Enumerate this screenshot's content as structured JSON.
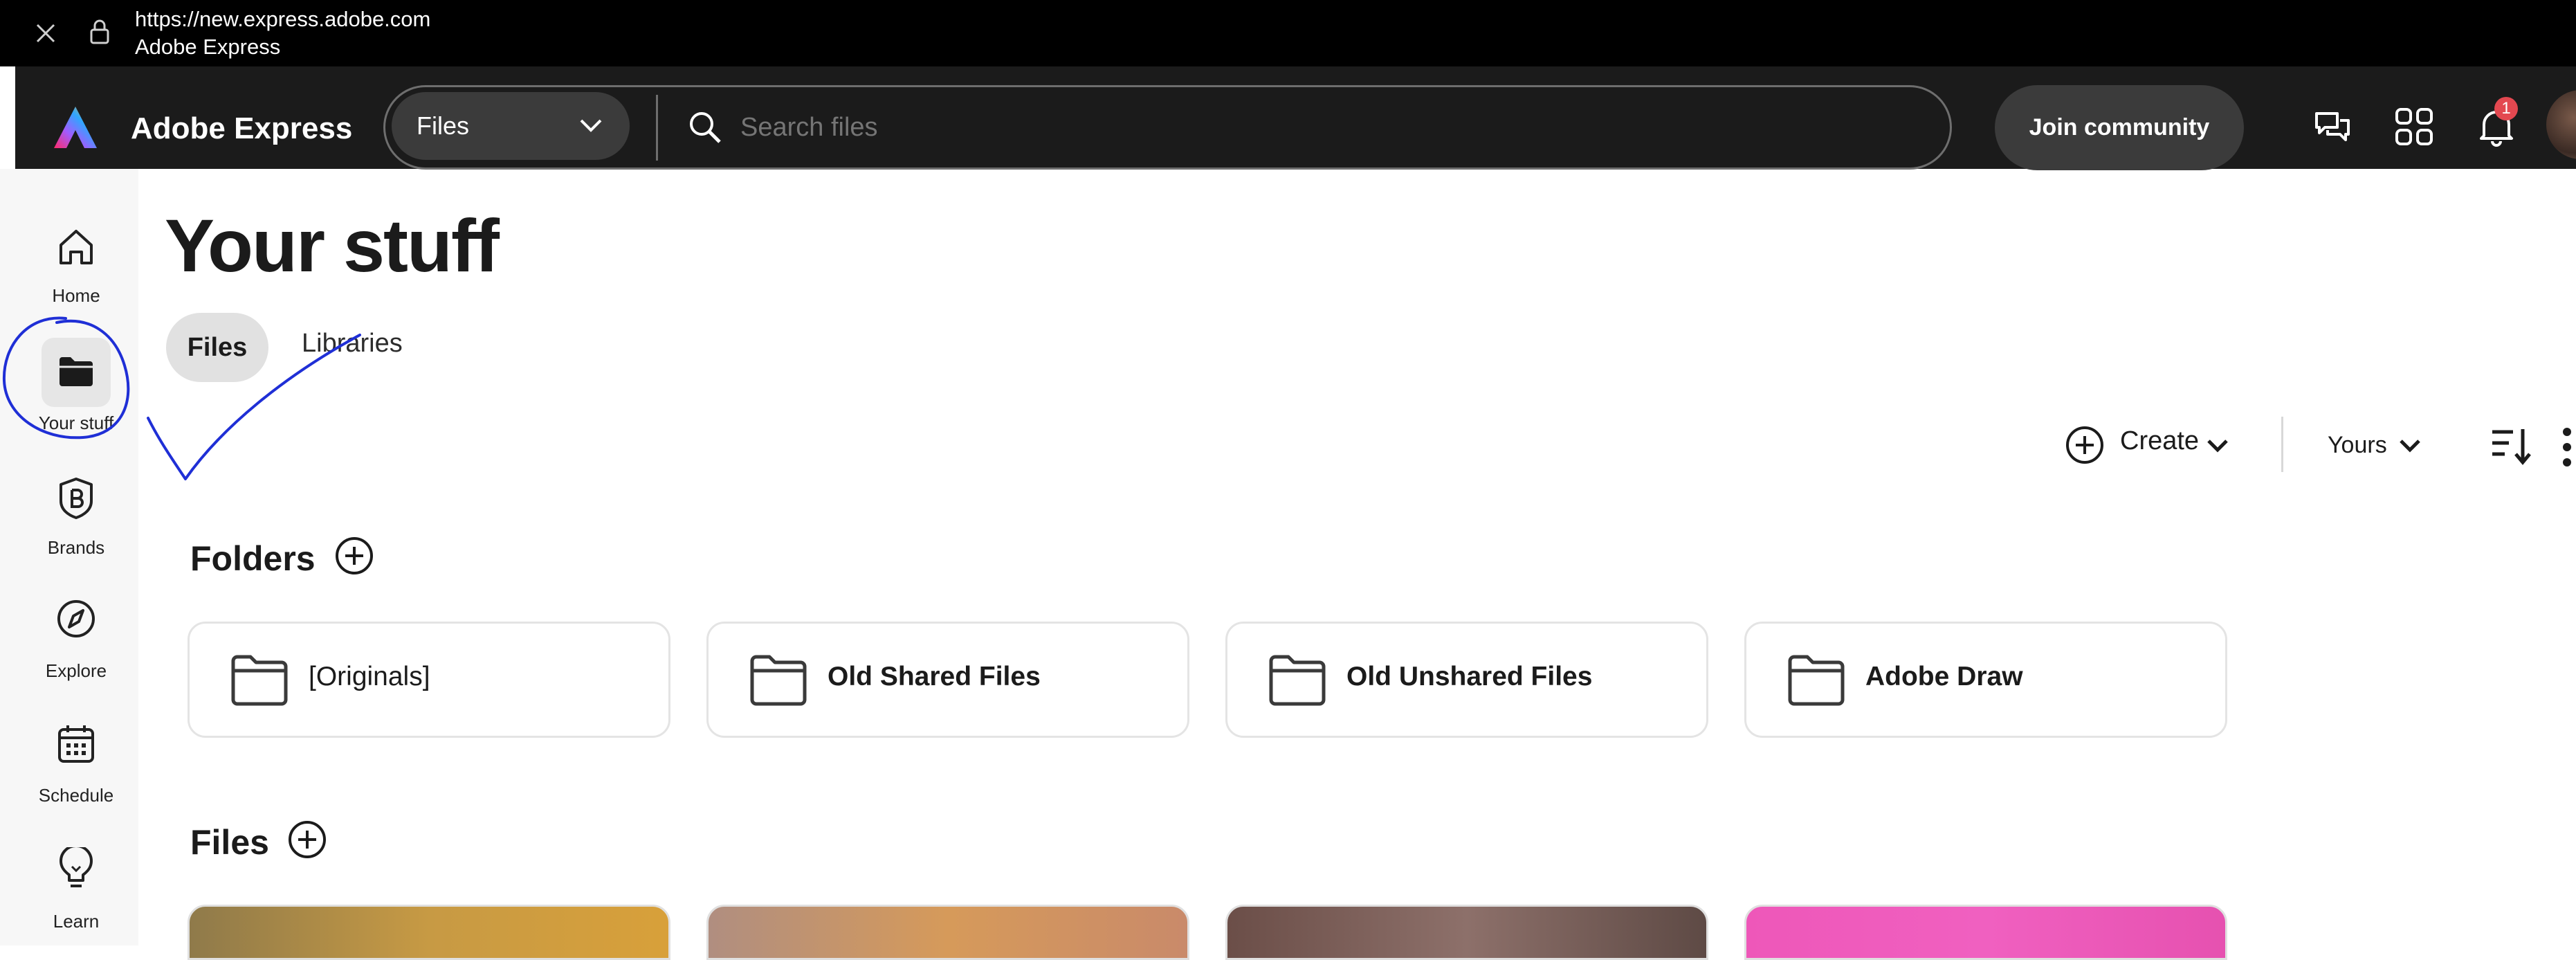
{
  "browser": {
    "url": "https://new.express.adobe.com",
    "page_title": "Adobe Express"
  },
  "header": {
    "app_name": "Adobe Express",
    "search_scope": "Files",
    "search_placeholder": "Search files",
    "join_button": "Join community",
    "notification_count": "1"
  },
  "sidebar": {
    "items": [
      {
        "label": "Home",
        "icon": "home-icon"
      },
      {
        "label": "Your stuff",
        "icon": "folder-icon"
      },
      {
        "label": "Brands",
        "icon": "brand-icon"
      },
      {
        "label": "Explore",
        "icon": "compass-icon"
      },
      {
        "label": "Schedule",
        "icon": "calendar-icon"
      },
      {
        "label": "Learn",
        "icon": "lightbulb-icon"
      }
    ]
  },
  "main": {
    "title": "Your stuff",
    "tabs": [
      {
        "label": "Files",
        "active": true
      },
      {
        "label": "Libraries",
        "active": false
      }
    ],
    "toolbar": {
      "create_label": "Create",
      "owner_filter": "Yours"
    },
    "folders_title": "Folders",
    "folders": [
      {
        "name": "[Originals]"
      },
      {
        "name": "Old Shared Files"
      },
      {
        "name": "Old Unshared Files"
      },
      {
        "name": "Adobe Draw"
      }
    ],
    "files_title": "Files"
  },
  "colors": {
    "header_bg": "#1b1b1b",
    "annotation": "#1f2fd6",
    "badge": "#e34850"
  }
}
